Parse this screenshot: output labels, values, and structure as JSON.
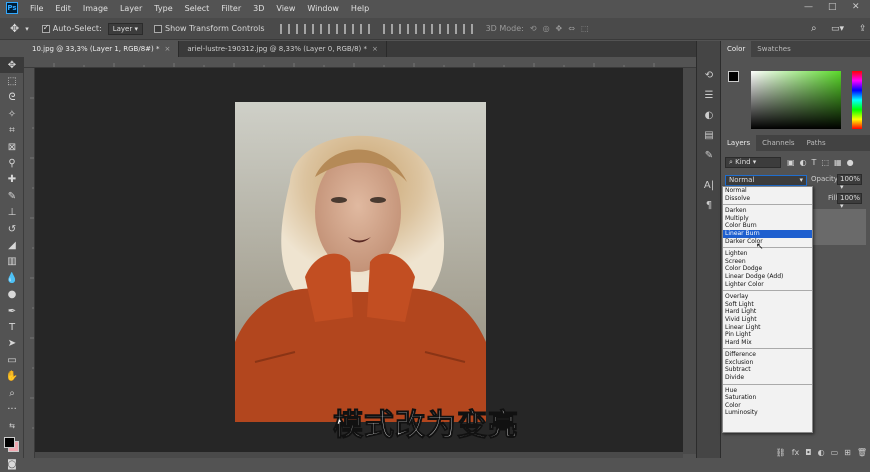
{
  "menubar": {
    "logo": "Ps",
    "items": [
      "File",
      "Edit",
      "Image",
      "Layer",
      "Type",
      "Select",
      "Filter",
      "3D",
      "View",
      "Window",
      "Help"
    ],
    "window_controls": [
      "—",
      "□",
      "✕"
    ]
  },
  "options": {
    "auto_select_label": "Auto-Select:",
    "auto_select_value": "Layer",
    "transform_label": "Show Transform Controls",
    "mode_3d": "3D Mode:"
  },
  "tabs": [
    {
      "label": "10.jpg @ 33,3% (Layer 1, RGB/8#) *",
      "close": "×"
    },
    {
      "label": "ariel-lustre-190312.jpg @ 8,33% (Layer 0, RGB/8) *",
      "close": "×"
    }
  ],
  "color_panel": {
    "tabs": [
      "Color",
      "Swatches"
    ],
    "fg": "#000000",
    "bg": "#f0a8b0"
  },
  "layers_panel": {
    "tabs": [
      "Layers",
      "Channels",
      "Paths"
    ],
    "kind_label": "Kind",
    "blend_mode": "Normal",
    "opacity_label": "Opacity:",
    "opacity_value": "100%",
    "fill_label": "Fill:",
    "fill_value": "100%"
  },
  "blend_dropdown": {
    "groups": [
      [
        "Normal",
        "Dissolve"
      ],
      [
        "Darken",
        "Multiply",
        "Color Burn",
        "Linear Burn",
        "Darker Color"
      ],
      [
        "Lighten",
        "Screen",
        "Color Dodge",
        "Linear Dodge (Add)",
        "Lighter Color"
      ],
      [
        "Overlay",
        "Soft Light",
        "Hard Light",
        "Vivid Light",
        "Linear Light",
        "Pin Light",
        "Hard Mix"
      ],
      [
        "Difference",
        "Exclusion",
        "Subtract",
        "Divide"
      ],
      [
        "Hue",
        "Saturation",
        "Color",
        "Luminosity"
      ]
    ],
    "highlighted": "Linear Burn"
  },
  "subtitle": "模式改为变亮"
}
